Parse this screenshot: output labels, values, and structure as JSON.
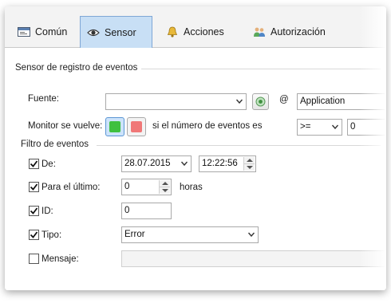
{
  "tabs": [
    {
      "label": "Común",
      "icon": "window-icon",
      "active": false
    },
    {
      "label": "Sensor",
      "icon": "eye-icon",
      "active": true
    },
    {
      "label": "Acciones",
      "icon": "bell-icon",
      "active": false
    },
    {
      "label": "Autorización",
      "icon": "users-icon",
      "active": false
    }
  ],
  "sensor_group": {
    "title": "Sensor de registro de eventos",
    "source_label": "Fuente:",
    "source_value": "",
    "at_symbol": "@",
    "log_value": "Application",
    "monitor_label": "Monitor se vuelve:",
    "green_color": "#3fc03f",
    "red_color": "#f07878",
    "condition_text": "si el número de eventos es",
    "operator_value": ">=",
    "count_value": "0"
  },
  "filter_group": {
    "title": "Filtro de eventos",
    "date_label": "De:",
    "date_checked": true,
    "date_value": "28.07.2015",
    "time_value": "12:22:56",
    "last_label": "Para el último:",
    "last_checked": true,
    "last_value": "0",
    "hours_label": "horas",
    "id_label": "ID:",
    "id_checked": true,
    "id_value": "0",
    "type_label": "Tipo:",
    "type_checked": true,
    "type_value": "Error",
    "message_label": "Mensaje:",
    "message_checked": false,
    "message_value": ""
  }
}
